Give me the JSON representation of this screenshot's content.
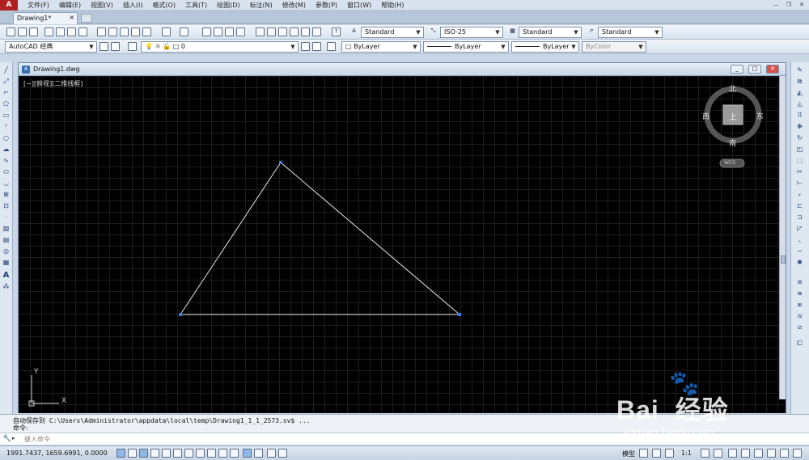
{
  "menubar": {
    "items": [
      "文件(F)",
      "编辑(E)",
      "视图(V)",
      "插入(I)",
      "格式(O)",
      "工具(T)",
      "绘图(D)",
      "标注(N)",
      "修改(M)",
      "参数(P)",
      "窗口(W)",
      "帮助(H)"
    ]
  },
  "tabs": {
    "doc_tab": "Drawing1*",
    "close": "×"
  },
  "toolbar1": {
    "text_style": "Standard",
    "dim_style": "ISO-25",
    "table_style": "Standard",
    "multileader_style": "Standard"
  },
  "toolbar2": {
    "workspace": "AutoCAD 经典",
    "layer": "0",
    "color": "ByLayer",
    "linetype": "ByLayer",
    "lineweight": "ByLayer",
    "plotstyle": "ByColor"
  },
  "drawing_window": {
    "title": "Drawing1.dwg",
    "viewport_label": "[−][俯视][二维线框]"
  },
  "viewcube": {
    "north": "北",
    "south": "南",
    "east": "东",
    "west": "西",
    "face": "上",
    "wcs": "WCS"
  },
  "ucs": {
    "x_label": "X",
    "y_label": "Y"
  },
  "command": {
    "history_line1": "自动保存到 C:\\Users\\Administrator\\appdata\\local\\temp\\Drawing1_1_1_2573.sv$ ...",
    "history_line2": "命令:",
    "placeholder": "键入命令"
  },
  "statusbar": {
    "coordinates": "1991.7437, 1659.6991, 0.0000",
    "model": "模型",
    "scale": "1:1"
  },
  "watermark": {
    "brand": "Bai",
    "brand2": "经验",
    "url": "jingyan.baidu.com"
  },
  "colors": {
    "canvas_bg": "#000000",
    "grip": "#3b7de0",
    "line": "#e8e8e8"
  }
}
